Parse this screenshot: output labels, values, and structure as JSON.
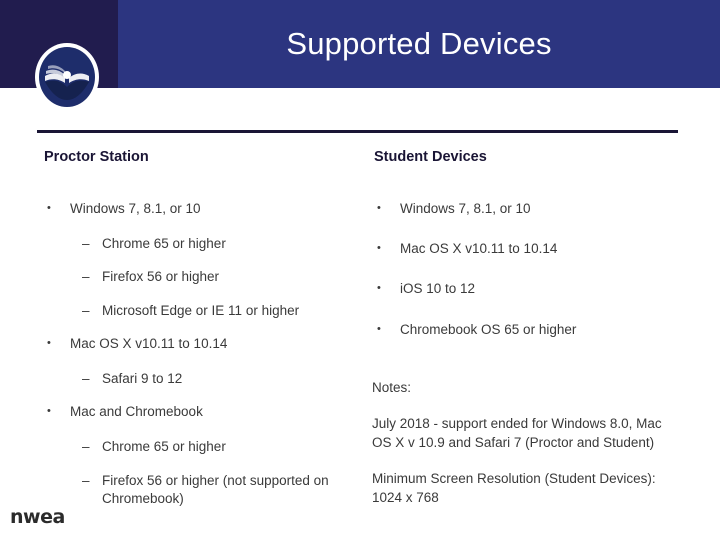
{
  "header": {
    "title": "Supported Devices",
    "logo_icon": "nwea-book-emblem-icon",
    "band_color": "#2c3580",
    "left_block_color": "#211c4e",
    "title_color": "#ffffff"
  },
  "divider": {
    "color": "#1a1535"
  },
  "columns": [
    {
      "heading": "Proctor Station",
      "items": [
        {
          "level": 1,
          "marker": "•",
          "text": "Windows 7, 8.1, or 10"
        },
        {
          "level": 2,
          "marker": "–",
          "text": "Chrome 65 or higher"
        },
        {
          "level": 2,
          "marker": "–",
          "text": "Firefox 56 or higher"
        },
        {
          "level": 2,
          "marker": "–",
          "text": "Microsoft Edge or IE 11 or higher"
        },
        {
          "level": 1,
          "marker": "•",
          "text": "Mac OS X v10.11 to 10.14"
        },
        {
          "level": 2,
          "marker": "–",
          "text": "Safari 9 to 12"
        },
        {
          "level": 1,
          "marker": "•",
          "text": "Mac and Chromebook"
        },
        {
          "level": 2,
          "marker": "–",
          "text": "Chrome 65 or higher"
        },
        {
          "level": 2,
          "marker": "–",
          "text": "Firefox 56 or higher (not supported on Chromebook)"
        }
      ]
    },
    {
      "heading": "Student Devices",
      "items": [
        {
          "level": 1,
          "marker": "•",
          "text": "Windows 7, 8.1, or 10"
        },
        {
          "level": 1,
          "marker": "•",
          "text": "Mac OS X v10.11 to 10.14"
        },
        {
          "level": 1,
          "marker": "•",
          "text": "iOS 10 to 12"
        },
        {
          "level": 1,
          "marker": "•",
          "text": "Chromebook OS 65 or higher"
        }
      ],
      "notes": {
        "label": "Notes:",
        "paragraphs": [
          "July 2018 - support ended for Windows 8.0, Mac OS X v 10.9 and Safari 7 (Proctor and Student)",
          "Minimum Screen Resolution (Student Devices): 1024 x 768"
        ]
      }
    }
  ],
  "footer": {
    "wordmark": "nwea"
  },
  "text_color": "#3a3a3a"
}
